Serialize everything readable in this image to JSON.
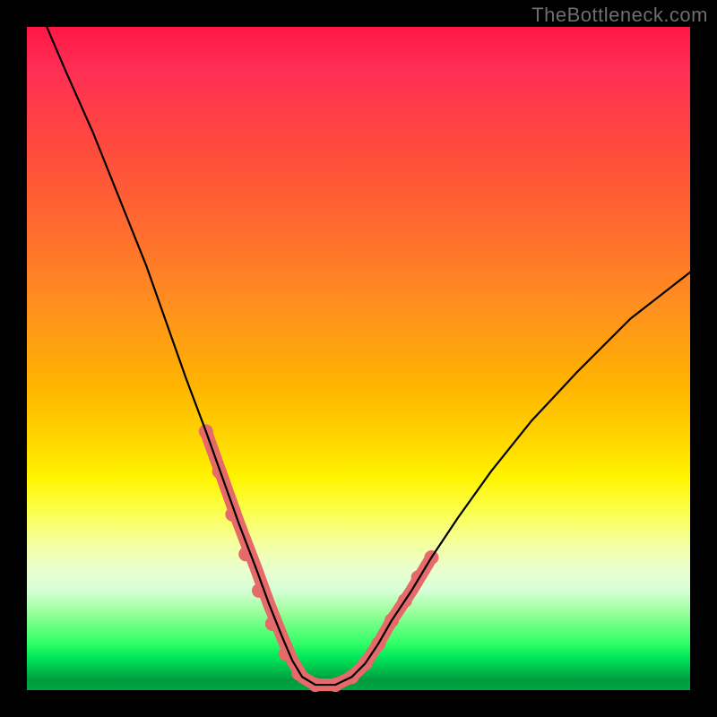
{
  "watermark": "TheBottleneck.com",
  "colors": {
    "curve": "#000000",
    "band": "#e66a6a",
    "dots": "#e66a6a",
    "frame_bg": "#000000"
  },
  "chart_data": {
    "type": "line",
    "title": "",
    "xlabel": "",
    "ylabel": "",
    "xlim": [
      0,
      100
    ],
    "ylim": [
      0,
      100
    ],
    "grid": false,
    "notes": "V-shaped bottleneck curve over rainbow heat ramp. Y encodes bottleneck severity (0 near bottom = green/good, 100 near top = red/bad). Salmon band and dots mark the recommended X-range near the valley.",
    "series": [
      {
        "name": "bottleneck-curve",
        "x": [
          3,
          6,
          10,
          14,
          18,
          21,
          24,
          27,
          29.5,
          32,
          34.5,
          36.5,
          38.5,
          40,
          41.5,
          43.5,
          46.5,
          49,
          51,
          53,
          55,
          58,
          61,
          65,
          70,
          76,
          83,
          91,
          100
        ],
        "y": [
          100,
          93,
          84,
          74,
          64,
          55.5,
          47,
          39,
          32,
          25,
          18.5,
          13,
          8,
          4.5,
          2,
          0.8,
          0.8,
          2,
          4,
          7,
          10.5,
          15,
          20,
          26,
          33,
          40.5,
          48,
          56,
          63
        ]
      }
    ],
    "highlight_band": {
      "name": "recommended-range-band",
      "left": {
        "x": [
          27,
          29.5,
          32,
          34.5,
          36.5,
          38.5
        ],
        "y": [
          39,
          32,
          25,
          18.5,
          13,
          8
        ]
      },
      "floor": {
        "x": [
          38.5,
          40,
          41.5,
          43.5,
          46.5,
          49,
          51
        ],
        "y": [
          8,
          4.5,
          2,
          0.8,
          0.8,
          2,
          4
        ]
      },
      "right": {
        "x": [
          51,
          53,
          55,
          58,
          61
        ],
        "y": [
          4,
          7,
          10.5,
          15,
          20
        ]
      }
    },
    "highlight_dots": {
      "name": "recommended-range-dots",
      "x": [
        27,
        29,
        31,
        33,
        35,
        37,
        39,
        41,
        43.5,
        46.5,
        49,
        51,
        53,
        55,
        57,
        59,
        61
      ],
      "y": [
        39,
        33,
        26.5,
        20.5,
        15,
        10,
        5.5,
        2.5,
        0.8,
        0.8,
        2,
        4,
        7,
        10.5,
        13.5,
        17,
        20
      ]
    }
  }
}
